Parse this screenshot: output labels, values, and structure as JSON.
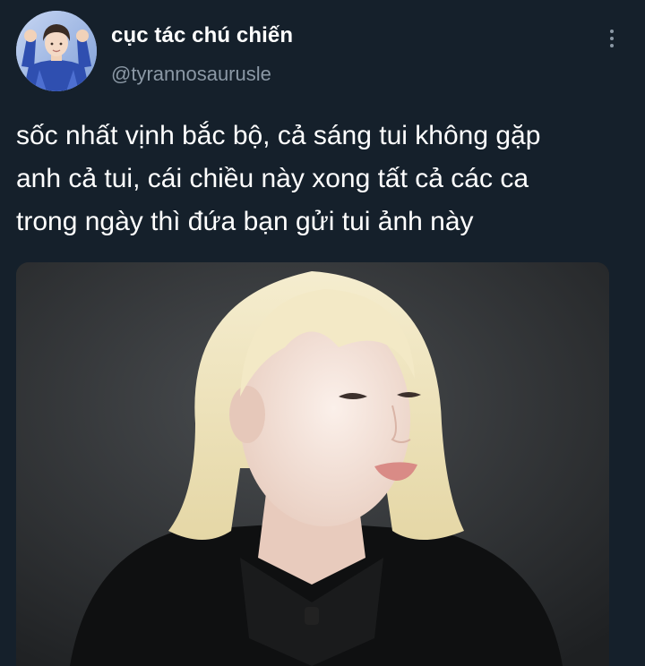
{
  "tweet": {
    "display_name": "cục tác chú chiến",
    "handle": "@tyrannosaurusle",
    "text_lines": [
      "sốc nhất vịnh bắc bộ, cả sáng tui không gặp",
      "anh cả tui, cái chiều này xong tất cả các ca",
      "trong ngày thì đứa bạn gửi tui ảnh này"
    ],
    "more_icon": "more-vertical-icon"
  },
  "colors": {
    "background": "#15202b",
    "primary_text": "#ffffff",
    "secondary_text": "#8b98a5"
  }
}
